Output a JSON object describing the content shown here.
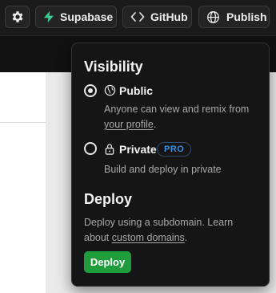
{
  "toolbar": {
    "settings_icon": "gear-icon",
    "supabase_label": "Supabase",
    "supabase_icon": "bolt-icon",
    "supabase_color": "#3ecf8e",
    "github_label": "GitHub",
    "github_icon": "code-icon",
    "publish_label": "Publish",
    "publish_icon": "globe-icon"
  },
  "popover": {
    "visibility_title": "Visibility",
    "options": [
      {
        "label": "Public",
        "icon": "globe-icon",
        "selected": true,
        "desc_prefix": "Anyone can view and remix from",
        "desc_link": "your profile",
        "desc_suffix": "."
      },
      {
        "label": "Private",
        "icon": "lock-icon",
        "selected": false,
        "badge": "PRO",
        "description": "Build and deploy in private"
      }
    ],
    "deploy_title": "Deploy",
    "deploy_desc_prefix": "Deploy using a subdomain. Learn about",
    "deploy_desc_link": "custom domains",
    "deploy_desc_suffix": ".",
    "deploy_button": "Deploy",
    "deploy_button_color": "#1f9d3d",
    "badge_color": "#3d8fe0"
  }
}
